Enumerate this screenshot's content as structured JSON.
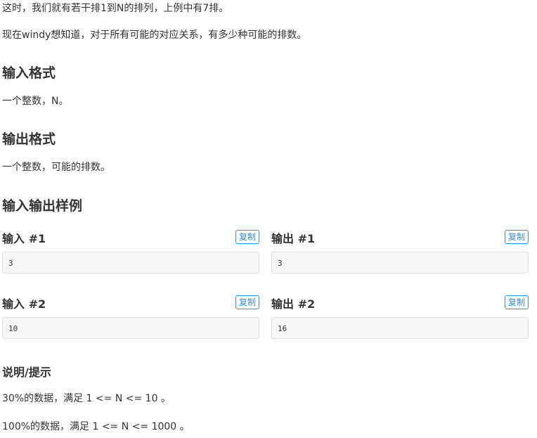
{
  "intro": {
    "line1": "这时，我们就有若干排1到N的排列，上例中有7排。",
    "line2": "现在windy想知道，对于所有可能的对应关系，有多少种可能的排数。"
  },
  "input_format": {
    "title": "输入格式",
    "text": "一个整数，N。"
  },
  "output_format": {
    "title": "输出格式",
    "text": "一个整数，可能的排数。"
  },
  "samples_section": {
    "title": "输入输出样例",
    "copy_label": "复制",
    "samples": [
      {
        "input_title": "输入 #1",
        "input_value": "3",
        "output_title": "输出 #1",
        "output_value": "3"
      },
      {
        "input_title": "输入 #2",
        "input_value": "10",
        "output_title": "输出 #2",
        "output_value": "16"
      }
    ]
  },
  "hint": {
    "title": "说明/提示",
    "line1": "30%的数据，满足 1 <= N <= 10 。",
    "line2": "100%的数据，满足 1 <= N <= 1000 。"
  }
}
